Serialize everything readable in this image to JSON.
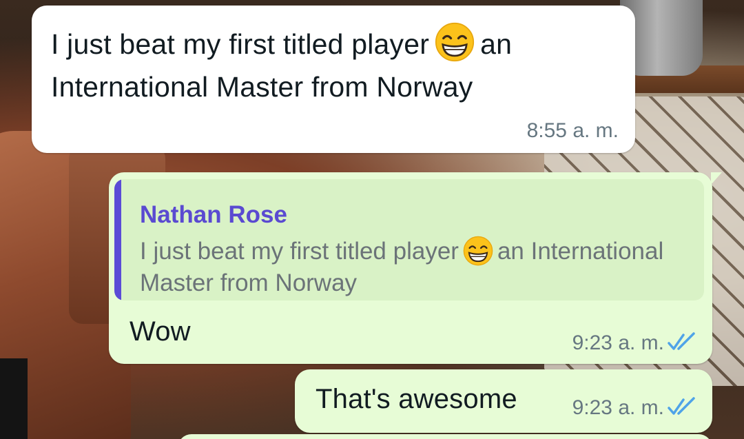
{
  "messages": {
    "incoming": {
      "text_before": "I just beat my first titled player",
      "emoji": "grinning-face-with-smiling-eyes",
      "text_after": "an International Master from Norway",
      "time": "8:55 a. m."
    },
    "reply": {
      "quoted_author": "Nathan Rose",
      "quoted_text_before": "I just beat my first titled player",
      "quoted_emoji": "grinning-face-with-smiling-eyes",
      "quoted_text_after": "an International Master from Norway",
      "text": "Wow",
      "time": "9:23 a. m.",
      "status_icon": "double-check-read-icon"
    },
    "outgoing_2": {
      "text": "That's awesome",
      "time": "9:23 a. m.",
      "status_icon": "double-check-read-icon"
    }
  },
  "colors": {
    "incoming_bubble": "#ffffff",
    "outgoing_bubble": "#e7fcd6",
    "quote_bar": "#5b4bd6",
    "quote_author": "#5a4ad1",
    "read_ticks": "#4fa3e8",
    "timestamp": "#667781"
  }
}
